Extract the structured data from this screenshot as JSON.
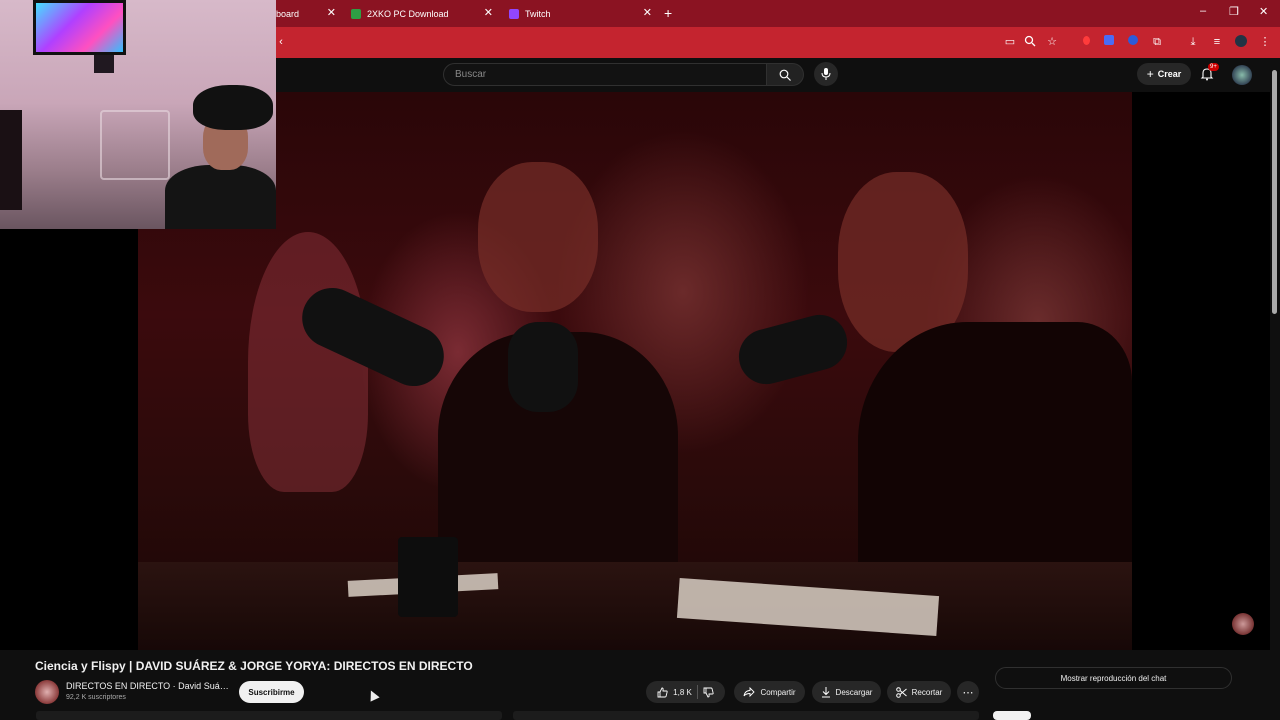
{
  "browser": {
    "tabs": [
      {
        "label": "board",
        "active": false
      },
      {
        "label": "2XKO PC Download",
        "active": false
      },
      {
        "label": "Twitch",
        "active": false
      }
    ],
    "new_tab": "+",
    "window_controls": {
      "minimize": "–",
      "restore": "❐",
      "close": "✕"
    }
  },
  "youtube": {
    "search": {
      "placeholder": "Buscar"
    },
    "create_label": "Crear",
    "notifications_badge": "9+"
  },
  "video": {
    "title": "Ciencia y Flispy | DAVID SUÁREZ & JORGE YORYA: DIRECTOS EN DIRECTO",
    "channel": {
      "name": "DIRECTOS EN DIRECTO · David Suá…",
      "subscribers": "92,2 K suscriptores"
    },
    "subscribe_label": "Suscribirme",
    "likes": "1,8 K",
    "share_label": "Compartir",
    "download_label": "Descargar",
    "clip_label": "Recortar",
    "more_label": "⋯",
    "chat_replay_label": "Mostrar reproducción del chat"
  },
  "colors": {
    "tabstrip": "#8b1322",
    "toolbar": "#c4242f",
    "page_bg": "#0f0f0f",
    "subscribe_bg": "#f1f1f1"
  }
}
